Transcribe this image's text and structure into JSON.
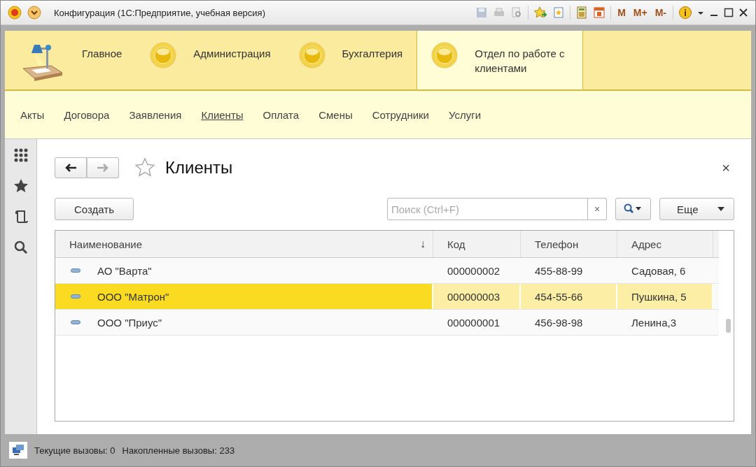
{
  "window": {
    "title": "Конфигурация  (1С:Предприятие, учебная версия)",
    "memory_buttons": [
      "M",
      "M+",
      "M-"
    ]
  },
  "sections": [
    {
      "label": "Главное",
      "kind": "lamp",
      "selected": false
    },
    {
      "label": "Администрация",
      "kind": "ball",
      "selected": false
    },
    {
      "label": "Бухгалтерия",
      "kind": "ball",
      "selected": false
    },
    {
      "label": "Отдел по работе с клиентами",
      "kind": "ball",
      "selected": true
    }
  ],
  "nav": [
    {
      "label": "Акты",
      "selected": false
    },
    {
      "label": "Договора",
      "selected": false
    },
    {
      "label": "Заявления",
      "selected": false
    },
    {
      "label": "Клиенты",
      "selected": true
    },
    {
      "label": "Оплата",
      "selected": false
    },
    {
      "label": "Смены",
      "selected": false
    },
    {
      "label": "Сотрудники",
      "selected": false
    },
    {
      "label": "Услуги",
      "selected": false
    }
  ],
  "form": {
    "title": "Клиенты",
    "close": "×",
    "create_button": "Создать",
    "search": {
      "placeholder": "Поиск (Ctrl+F)",
      "clear": "×"
    },
    "more_button": "Еще"
  },
  "table": {
    "columns": [
      {
        "label": "Наименование",
        "sort": "↓"
      },
      {
        "label": "Код"
      },
      {
        "label": "Телефон"
      },
      {
        "label": "Адрес"
      }
    ],
    "rows": [
      {
        "cells": [
          "АО \"Варта\"",
          "000000002",
          "455-88-99",
          "Садовая, 6"
        ],
        "selected": false
      },
      {
        "cells": [
          "ООО \"Матрон\"",
          "000000003",
          "454-55-66",
          "Пушкина, 5"
        ],
        "selected": true
      },
      {
        "cells": [
          "ООО \"Приус\"",
          "000000001",
          "456-98-98",
          "Ленина,3"
        ],
        "selected": false
      }
    ]
  },
  "status_bar": {
    "current": "Текущие вызовы: 0",
    "accumulated": "Накопленные вызовы: 233"
  }
}
